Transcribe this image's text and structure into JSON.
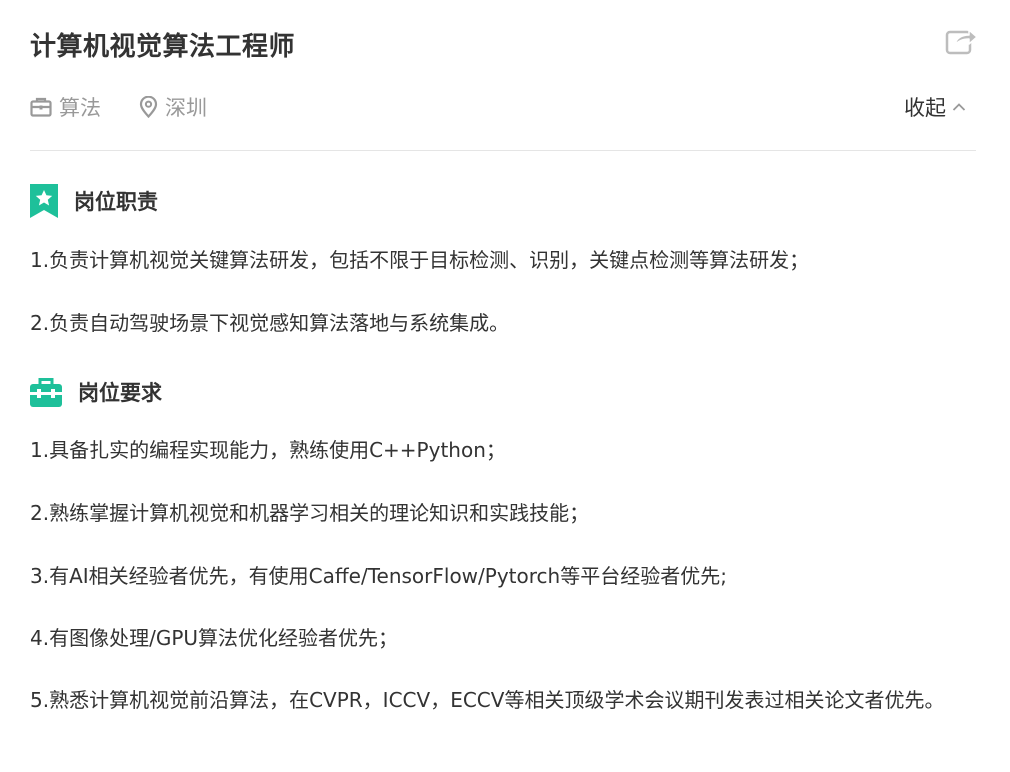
{
  "job": {
    "title": "计算机视觉算法工程师",
    "category": "算法",
    "location": "深圳",
    "collapse_label": "收起"
  },
  "sections": [
    {
      "title": "岗位职责",
      "icon": "badge-star-icon",
      "items": [
        "1.负责计算机视觉关键算法研发，包括不限于目标检测、识别，关键点检测等算法研发；",
        "2.负责自动驾驶场景下视觉感知算法落地与系统集成。"
      ]
    },
    {
      "title": "岗位要求",
      "icon": "toolbox-icon",
      "items": [
        "1.具备扎实的编程实现能力，熟练使用C++Python；",
        "2.熟练掌握计算机视觉和机器学习相关的理论知识和实践技能；",
        "3.有AI相关经验者优先，有使用Caffe/TensorFlow/Pytorch等平台经验者优先;",
        "4.有图像处理/GPU算法优化经验者优先；",
        "5.熟悉计算机视觉前沿算法，在CVPR，ICCV，ECCV等相关顶级学术会议期刊发表过相关论文者优先。"
      ]
    }
  ],
  "colors": {
    "accent": "#1ec09a",
    "text": "#333333",
    "muted": "#999999",
    "divider": "#e5e5e5"
  },
  "icons": {
    "share": "share-icon",
    "category": "briefcase-icon",
    "location": "location-pin-icon",
    "collapse": "chevron-up-icon"
  }
}
